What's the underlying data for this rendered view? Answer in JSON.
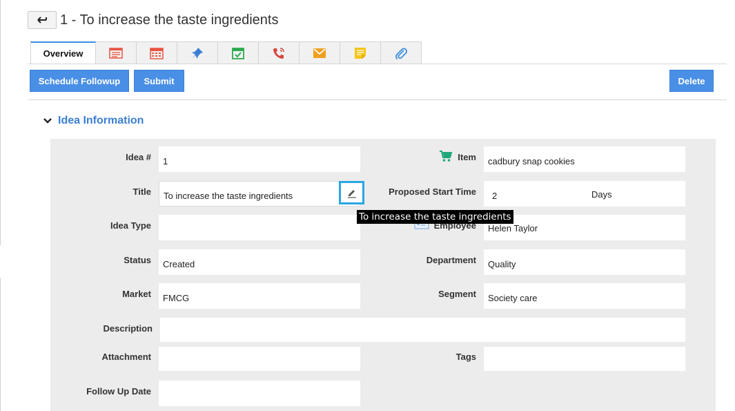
{
  "header": {
    "title": "1 - To increase the taste ingredients"
  },
  "tabs": {
    "overview": "Overview",
    "icons": [
      "list-icon",
      "calendar-icon",
      "pin-icon",
      "task-icon",
      "phone-icon",
      "mail-icon",
      "note-icon",
      "attachment-icon"
    ],
    "colors": [
      "#e8543f",
      "#e8543f",
      "#3b7fd4",
      "#2fa84f",
      "#d9453c",
      "#f0a020",
      "#f5c518",
      "#3b8de0"
    ]
  },
  "toolbar": {
    "schedule_followup": "Schedule Followup",
    "submit": "Submit",
    "delete": "Delete"
  },
  "section": {
    "title": "Idea Information"
  },
  "form": {
    "idea_no_label": "Idea #",
    "idea_no_value": "1",
    "item_label": "Item",
    "item_value": "cadbury snap cookies",
    "title_label": "Title",
    "title_value": "To increase the taste ingredients",
    "proposed_start_label": "Proposed Start Time",
    "proposed_start_value": "2",
    "proposed_start_unit": "Days",
    "idea_type_label": "Idea Type",
    "idea_type_value": "",
    "employee_label": "Employee",
    "employee_value": "Helen Taylor",
    "status_label": "Status",
    "status_value": "Created",
    "department_label": "Department",
    "department_value": "Quality",
    "market_label": "Market",
    "market_value": "FMCG",
    "segment_label": "Segment",
    "segment_value": "Society care",
    "description_label": "Description",
    "description_value": "",
    "attachment_label": "Attachment",
    "tags_label": "Tags",
    "follow_up_label": "Follow Up Date"
  },
  "tooltip": {
    "text": "To increase the taste ingredients"
  },
  "colors": {
    "accent": "#4a8fe6",
    "link": "#3b7fd4",
    "panel": "#ececec",
    "focus": "#29a7e1",
    "cart": "#1fa67a"
  }
}
